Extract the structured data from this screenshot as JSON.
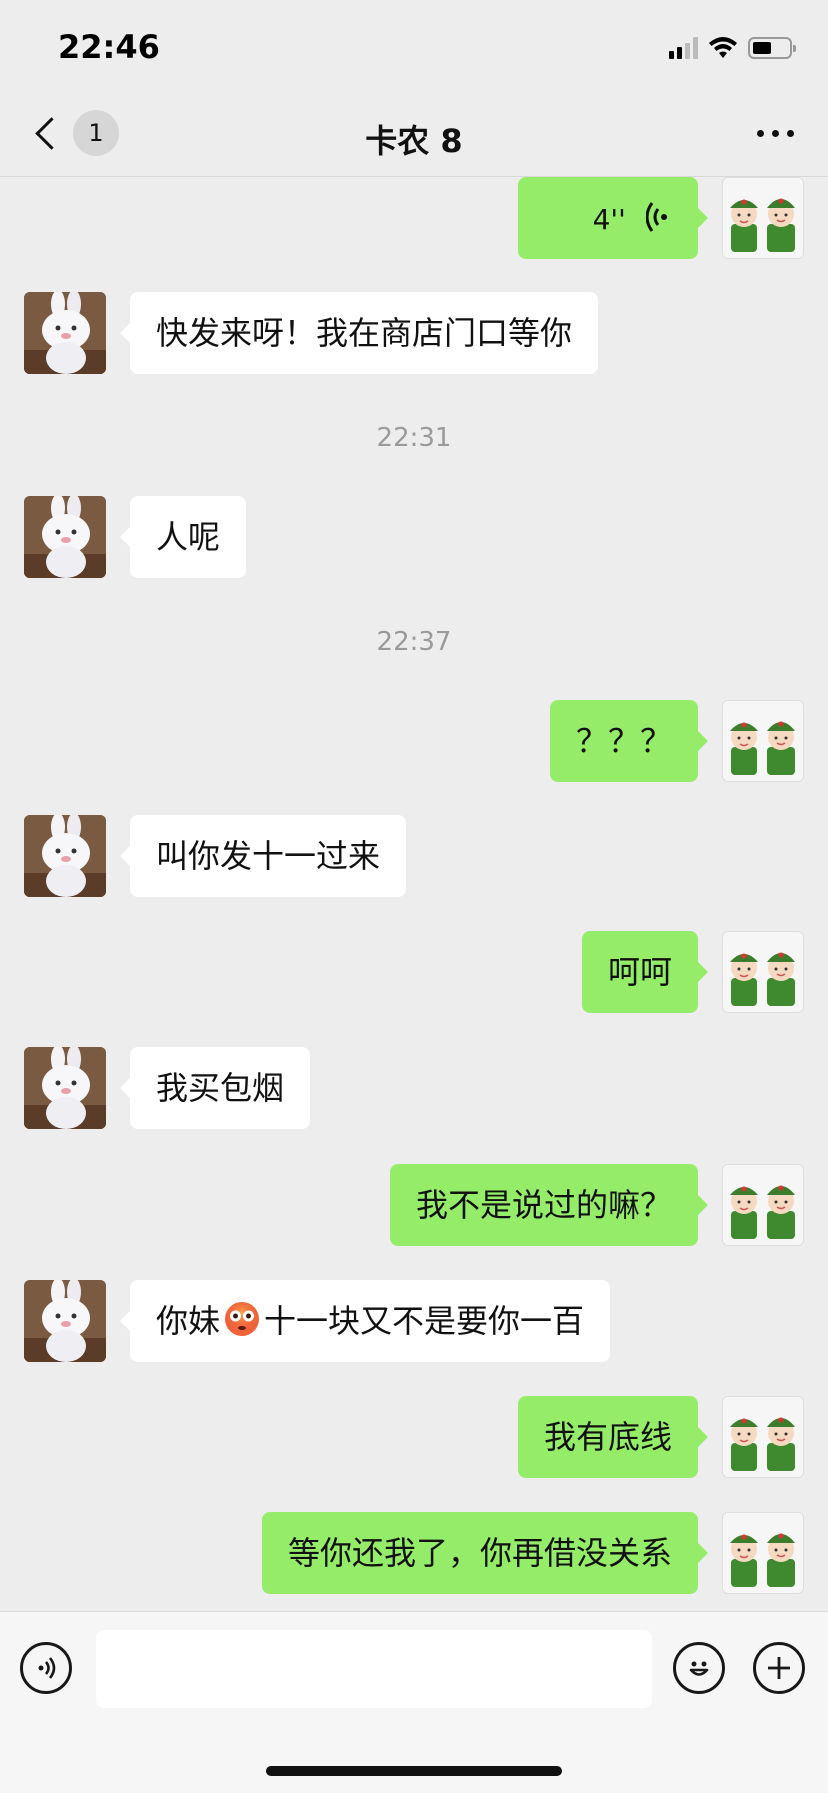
{
  "status_bar": {
    "time": "22:46"
  },
  "nav": {
    "back_badge": "1",
    "title": "卡农 8"
  },
  "messages": [
    {
      "type": "voice",
      "side": "right",
      "duration": "4''"
    },
    {
      "type": "text",
      "side": "left",
      "text": "快发来呀！我在商店门口等你"
    },
    {
      "type": "time",
      "text": "22:31"
    },
    {
      "type": "text",
      "side": "left",
      "text": "人呢"
    },
    {
      "type": "time",
      "text": "22:37"
    },
    {
      "type": "text",
      "side": "right",
      "text": "？？？"
    },
    {
      "type": "text",
      "side": "left",
      "text": "叫你发十一过来"
    },
    {
      "type": "text",
      "side": "right",
      "text": "呵呵"
    },
    {
      "type": "text",
      "side": "left",
      "text": "我买包烟"
    },
    {
      "type": "text",
      "side": "right",
      "text": "我不是说过的嘛？"
    },
    {
      "type": "text",
      "side": "left",
      "text_before": "你妹",
      "emoji": "flushed-face",
      "text_after": "十一块又不是要你一百"
    },
    {
      "type": "text",
      "side": "right",
      "text": "我有底线"
    },
    {
      "type": "text",
      "side": "right",
      "text": "等你还我了，你再借没关系"
    }
  ],
  "input": {
    "value": "",
    "placeholder": ""
  },
  "colors": {
    "background": "#ededed",
    "bubble_self": "#95ec69",
    "bubble_other": "#ffffff"
  },
  "icons": {
    "voice_button": "voice-icon",
    "emoji_button": "smiley-icon",
    "plus_button": "plus-icon"
  }
}
